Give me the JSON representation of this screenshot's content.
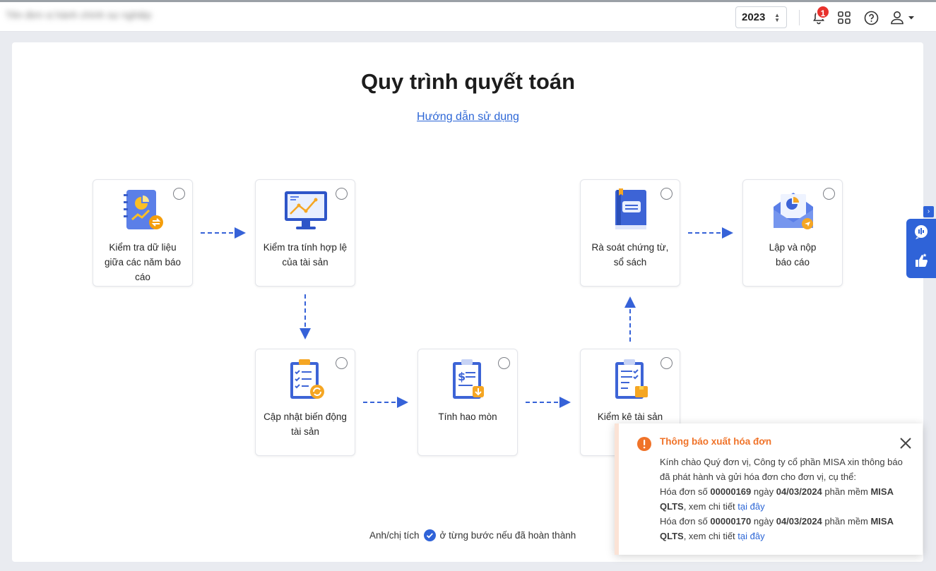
{
  "header": {
    "org_name": "Tên đơn vị hành chính sự nghiệp",
    "year": "2023",
    "notification_count": "1"
  },
  "main": {
    "title": "Quy trình quyết toán",
    "guide_link": "Hướng dẫn sử dụng",
    "hint_before": "Anh/chị tích",
    "hint_after": "ở từng bước nếu đã hoàn thành"
  },
  "steps": [
    {
      "line1": "Kiểm tra dữ liệu",
      "line2": "giữa các năm báo cáo",
      "icon": "report-compare-icon"
    },
    {
      "line1": "Kiểm tra tính hợp lệ",
      "line2": "của tài sản",
      "icon": "monitor-chart-icon"
    },
    {
      "line1": "Rà soát chứng từ,",
      "line2": "sổ sách",
      "icon": "ledger-book-icon"
    },
    {
      "line1": "Lập và nộp",
      "line2": "báo cáo",
      "icon": "envelope-report-icon"
    },
    {
      "line1": "Cập nhật biến động",
      "line2": "tài sản",
      "icon": "checklist-refresh-icon"
    },
    {
      "line1": "Tính hao mòn",
      "line2": "",
      "icon": "clipboard-dollar-icon"
    },
    {
      "line1": "Kiểm kê tài sản",
      "line2": "",
      "icon": "checklist-box-icon"
    }
  ],
  "toast": {
    "title": "Thông báo xuất hóa đơn",
    "intro": "Kính chào Quý đơn vị, Công ty cổ phần MISA xin thông báo đã phát hành và gửi hóa đơn cho đơn vị, cụ thể:",
    "inv_prefix": "Hóa đơn số",
    "inv_mid": "ngày",
    "inv_sw": "phần mềm",
    "inv_detail": ", xem chi tiết",
    "link": "tại đây",
    "invoices": [
      {
        "number": "00000169",
        "date": "04/03/2024",
        "software": "MISA QLTS"
      },
      {
        "number": "00000170",
        "date": "04/03/2024",
        "software": "MISA QLTS"
      }
    ]
  },
  "colors": {
    "accent": "#2f63d8",
    "link": "#2c66d6",
    "warning": "#f07329",
    "badge": "#e8312c"
  }
}
